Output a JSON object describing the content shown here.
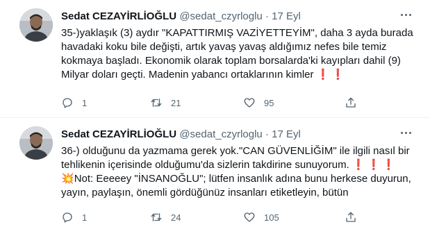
{
  "tweets": [
    {
      "author": {
        "name": "Sedat CEZAYİRLİOĞLU",
        "handle": "@sedat_czyrloglu",
        "separator": "·",
        "date": "17 Eyl"
      },
      "text": {
        "line1": "35-)yaklaşık (3) aydır \"KAPATTIRMIŞ VAZİYETTEYİM\", daha 3 ayda burada havadaki koku bile değişti, artık yavaş yavaş aldığımız nefes bile temiz kokmaya başladı.  Ekonomik olarak toplam borsalarda'ki kayıpları dahil (9) Milyar doları geçti. Madenin yabancı ortaklarının kimler",
        "emoji": "❗❗"
      },
      "stats": {
        "replies": "1",
        "retweets": "21",
        "likes": "95"
      }
    },
    {
      "author": {
        "name": "Sedat CEZAYİRLİOĞLU",
        "handle": "@sedat_czyrloglu",
        "separator": "·",
        "date": "17 Eyl"
      },
      "text": {
        "line1": "36-) olduğunu da yazmama gerek yok.\"CAN GÜVENLİĞİM\" ile ilgili nasıl bir tehlikenin içerisinde olduğumu'da sizlerin takdirine sunuyorum.",
        "emoji": "❗❗❗",
        "boom": "💥",
        "line2": "Not: Eeeeey \"İNSANOĞLU\"; lütfen insanlık adına bunu herkese duyurun, yayın, paylaşın, önemli gördüğünüz insanları etiketleyin, bütün"
      },
      "stats": {
        "replies": "1",
        "retweets": "24",
        "likes": "105"
      }
    }
  ],
  "icons": {
    "reply": "reply-icon",
    "retweet": "retweet-icon",
    "like": "heart-icon",
    "share": "share-icon",
    "more": "more-options-icon"
  },
  "colors": {
    "text": "#0f1419",
    "muted": "#536471",
    "emoji_red": "#e0245e",
    "divider": "#eff3f4"
  }
}
